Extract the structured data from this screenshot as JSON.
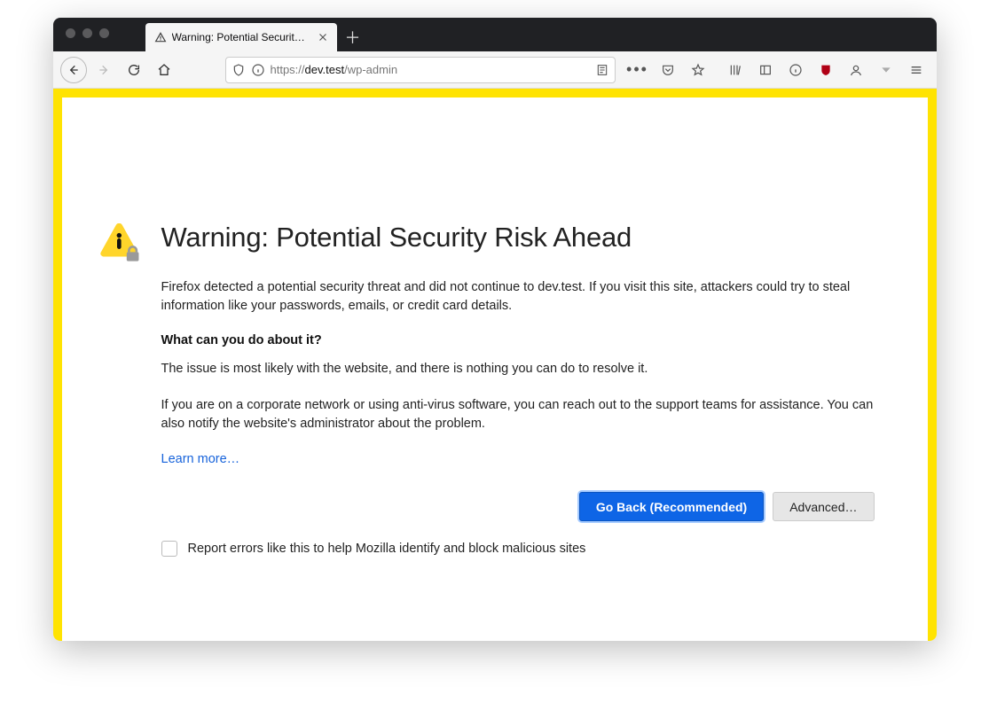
{
  "window": {
    "tab_title": "Warning: Potential Security Risk"
  },
  "urlbar": {
    "scheme": "https://",
    "host": "dev.test",
    "path": "/wp-admin"
  },
  "page": {
    "heading": "Warning: Potential Security Risk Ahead",
    "para1": "Firefox detected a potential security threat and did not continue to dev.test. If you visit this site, attackers could try to steal information like your passwords, emails, or credit card details.",
    "subhead": "What can you do about it?",
    "para2": "The issue is most likely with the website, and there is nothing you can do to resolve it.",
    "para3": "If you are on a corporate network or using anti-virus software, you can reach out to the support teams for assistance. You can also notify the website's administrator about the problem.",
    "learn_more": "Learn more…",
    "go_back": "Go Back (Recommended)",
    "advanced": "Advanced…",
    "report_label": "Report errors like this to help Mozilla identify and block malicious sites"
  }
}
